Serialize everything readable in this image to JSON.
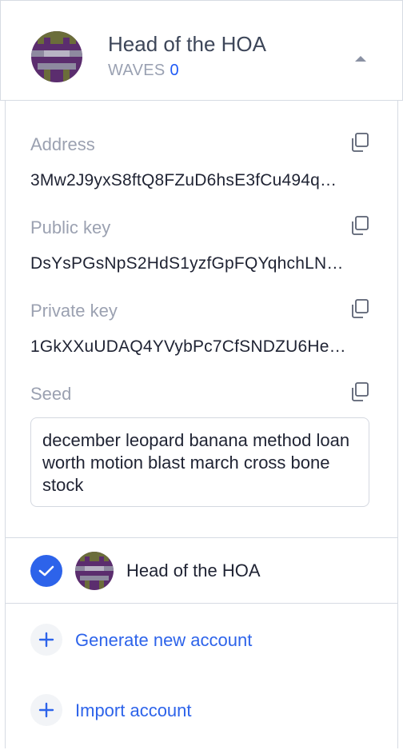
{
  "header": {
    "account_name": "Head of the HOA",
    "currency": "WAVES",
    "balance": "0"
  },
  "details": {
    "address_label": "Address",
    "address_value": "3Mw2J9yxS8ftQ8FZuD6hsE3fCu494q…",
    "public_key_label": "Public key",
    "public_key_value": "DsYsPGsNpS2HdS1yzfGpFQYqhchLN…",
    "private_key_label": "Private key",
    "private_key_value": "1GkXXuUDAQ4YVybPc7CfSNDZU6He…",
    "seed_label": "Seed",
    "seed_value": "december leopard banana method loan worth motion blast march cross bone stock"
  },
  "accounts": [
    {
      "name": "Head of the HOA",
      "selected": true
    }
  ],
  "actions": {
    "generate_label": "Generate new account",
    "import_label": "Import account"
  },
  "icons": {
    "collapse": "chevron-up-icon",
    "copy": "copy-icon",
    "check": "checkmark-icon",
    "add": "plus-icon"
  },
  "colors": {
    "accent": "#2d63ea",
    "balance": "#1f5af6",
    "muted": "#9ba1b1",
    "avatar_purple": "#5b2d6e",
    "avatar_olive": "#6b6d3a"
  }
}
